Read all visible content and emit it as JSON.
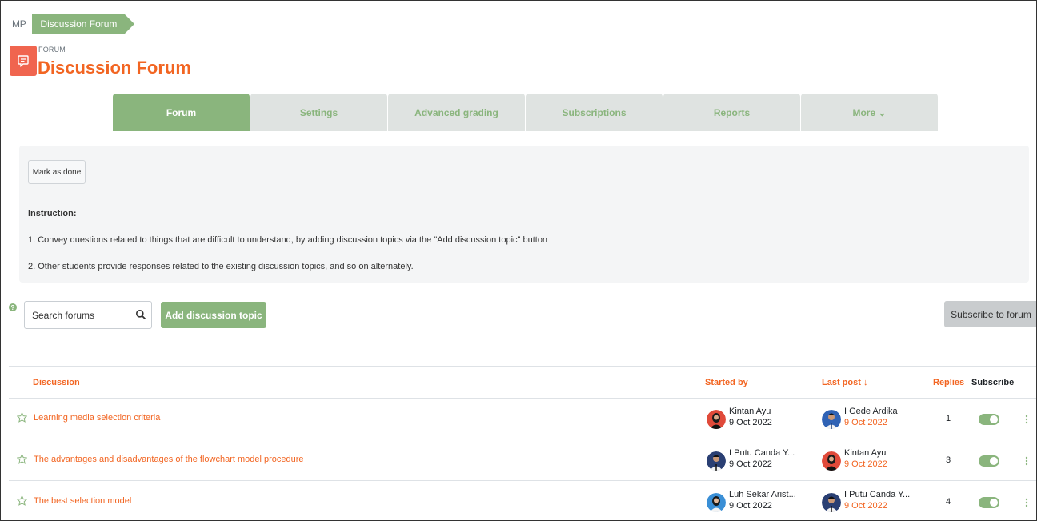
{
  "breadcrumb": {
    "root": "MP",
    "current": "Discussion Forum"
  },
  "header": {
    "module_label": "FORUM",
    "title": "Discussion Forum"
  },
  "tabs": [
    {
      "label": "Forum",
      "active": true
    },
    {
      "label": "Settings"
    },
    {
      "label": "Advanced grading"
    },
    {
      "label": "Subscriptions"
    },
    {
      "label": "Reports"
    },
    {
      "label": "More ⌄"
    }
  ],
  "panel": {
    "mark_done": "Mark as done",
    "instruction_title": "Instruction:",
    "lines": [
      "1. Convey questions related to things that are difficult to understand, by adding discussion topics via the \"Add discussion topic\" button",
      "2. Other students provide responses related to the existing discussion topics, and so on alternately."
    ]
  },
  "controls": {
    "search_placeholder": "Search forums",
    "add_topic": "Add discussion topic",
    "subscribe_forum": "Subscribe to forum"
  },
  "table": {
    "headers": {
      "discussion": "Discussion",
      "started_by": "Started by",
      "last_post": "Last post ↓",
      "replies": "Replies",
      "subscribe": "Subscribe"
    },
    "rows": [
      {
        "title": "Learning media selection criteria",
        "starter": "Kintan Ayu",
        "started": "9 Oct 2022",
        "last_user": "I Gede Ardika",
        "last_date": "9 Oct 2022",
        "replies": "1"
      },
      {
        "title": "The advantages and disadvantages of the flowchart model procedure",
        "starter": "I Putu Canda Y...",
        "started": "9 Oct 2022",
        "last_user": "Kintan Ayu",
        "last_date": "9 Oct 2022",
        "replies": "3"
      },
      {
        "title": "The best selection model",
        "starter": "Luh Sekar Arist...",
        "started": "9 Oct 2022",
        "last_user": "I Putu Canda Y...",
        "last_date": "9 Oct 2022",
        "replies": "4"
      }
    ]
  },
  "colors": {
    "accent_green": "#8ab57d",
    "accent_orange": "#f26522",
    "icon_red": "#f0654f"
  }
}
